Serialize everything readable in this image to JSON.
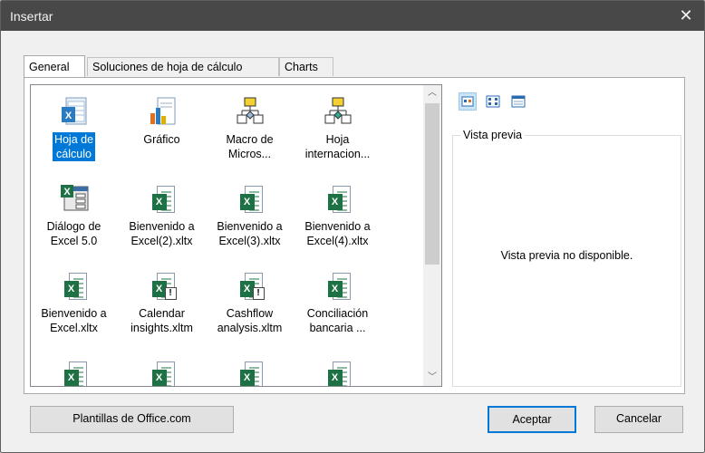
{
  "window": {
    "title": "Insertar",
    "close_glyph": "✕"
  },
  "tabs": [
    {
      "label": "General",
      "active": true
    },
    {
      "label": "Soluciones de hoja de cálculo",
      "active": false
    },
    {
      "label": "Charts",
      "active": false
    }
  ],
  "items": [
    {
      "label": "Hoja de\ncálculo",
      "icon": "worksheet-icon",
      "selected": true
    },
    {
      "label": "Gráfico",
      "icon": "chart-icon",
      "selected": false
    },
    {
      "label": "Macro de\nMicros...",
      "icon": "macro-icon",
      "selected": false
    },
    {
      "label": "Hoja\ninternacion...",
      "icon": "intl-macro-icon",
      "selected": false
    },
    {
      "label": "Diálogo de\nExcel 5.0",
      "icon": "dialog-icon",
      "selected": false
    },
    {
      "label": "Bienvenido a\nExcel(2).xltx",
      "icon": "excel-template-icon",
      "selected": false
    },
    {
      "label": "Bienvenido a\nExcel(3).xltx",
      "icon": "excel-template-icon",
      "selected": false
    },
    {
      "label": "Bienvenido a\nExcel(4).xltx",
      "icon": "excel-template-icon",
      "selected": false
    },
    {
      "label": "Bienvenido a\nExcel.xltx",
      "icon": "excel-template-icon",
      "selected": false
    },
    {
      "label": "Calendar\ninsights.xltm",
      "icon": "excel-macro-template-icon",
      "selected": false
    },
    {
      "label": "Cashflow\nanalysis.xltm",
      "icon": "excel-macro-template-icon",
      "selected": false
    },
    {
      "label": "Conciliación\nbancaria ...",
      "icon": "excel-template-icon",
      "selected": false
    },
    {
      "label": "",
      "icon": "excel-template-icon",
      "selected": false
    },
    {
      "label": "",
      "icon": "excel-template-icon",
      "selected": false
    },
    {
      "label": "",
      "icon": "excel-template-icon",
      "selected": false
    },
    {
      "label": "",
      "icon": "excel-template-icon",
      "selected": false
    }
  ],
  "view_buttons": [
    {
      "icon": "large-icons-view-icon",
      "active": true
    },
    {
      "icon": "list-view-icon",
      "active": false
    },
    {
      "icon": "details-view-icon",
      "active": false
    }
  ],
  "preview": {
    "legend": "Vista previa",
    "message": "Vista previa no disponible."
  },
  "buttons": {
    "office_templates": "Plantillas de Office.com",
    "accept": "Aceptar",
    "cancel": "Cancelar"
  },
  "colors": {
    "titlebar": "#484848",
    "selection": "#0078d7",
    "excel_green": "#1e7145"
  }
}
